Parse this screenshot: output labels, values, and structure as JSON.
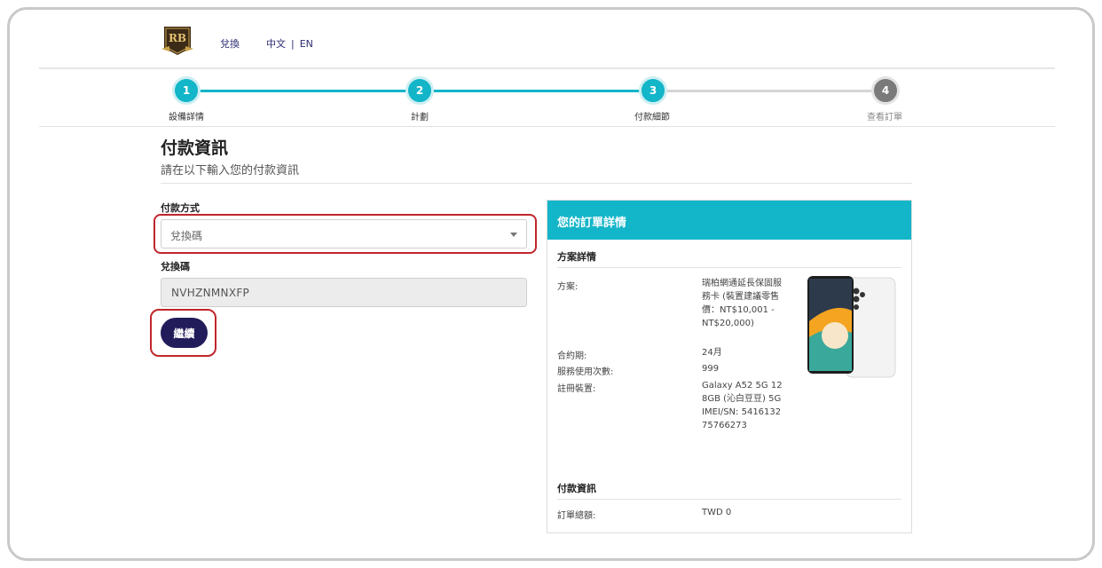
{
  "header": {
    "logo_text": "RB",
    "nav_link": "兌換",
    "lang_zh": "中文",
    "lang_sep": "|",
    "lang_en": "EN"
  },
  "stepper": [
    {
      "number": "1",
      "label": "設備詳情",
      "active": true
    },
    {
      "number": "2",
      "label": "計劃",
      "active": true
    },
    {
      "number": "3",
      "label": "付款細節",
      "active": true
    },
    {
      "number": "4",
      "label": "查看訂單",
      "active": false
    }
  ],
  "page": {
    "title": "付款資訊",
    "subtitle": "請在以下輸入您的付款資訊"
  },
  "form": {
    "payment_method_label": "付款方式",
    "payment_method_value": "兌換碼",
    "code_label": "兌換碼",
    "code_value": "NVHZNMNXFP",
    "continue_label": "繼續"
  },
  "order": {
    "header": "您的訂單詳情",
    "plan_section": "方案詳情",
    "rows": [
      {
        "label": "方案:",
        "value": "瑞柏網通延長保固服務卡 (裝置建議零售價：NT$10,001 - NT$20,000)"
      },
      {
        "label": "合約期:",
        "value": "24月"
      },
      {
        "label": "服務使用次數:",
        "value": "999"
      },
      {
        "label": "註冊裝置:",
        "value": "Galaxy A52 5G 128GB (沁白豆豆) 5G IMEI/SN: 541613275766273"
      }
    ],
    "payment_section": "付款資訊",
    "total_label": "訂單總額:",
    "total_value": "TWD 0"
  },
  "colors": {
    "accent": "#13b5c8",
    "button": "#221c5a",
    "highlight": "#c0262b",
    "link": "#2b2c73"
  }
}
